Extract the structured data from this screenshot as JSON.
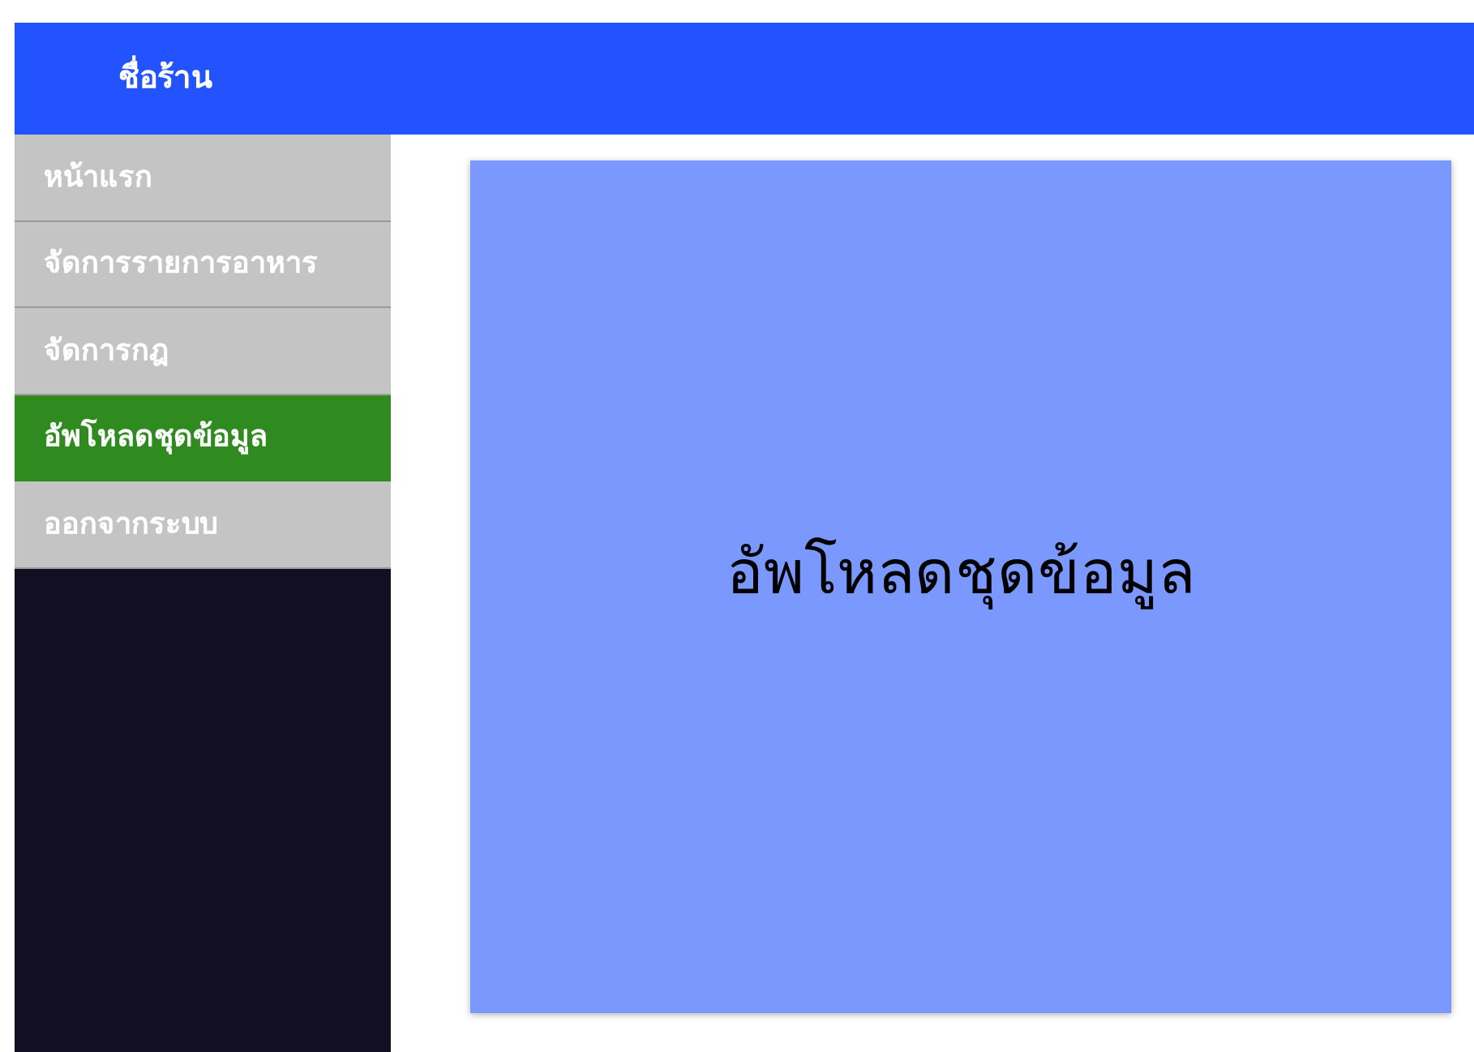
{
  "header": {
    "title": "ชื่อร้าน"
  },
  "sidebar": {
    "items": [
      {
        "label": "หน้าแรก",
        "selected": false
      },
      {
        "label": "จัดการรายการอาหาร",
        "selected": false
      },
      {
        "label": "จัดการกฎ",
        "selected": false
      },
      {
        "label": "อัพโหลดชุดข้อมูล",
        "selected": true
      },
      {
        "label": "ออกจากระบบ",
        "selected": false
      }
    ]
  },
  "main": {
    "heading": "อัพโหลดชุดข้อมูล"
  }
}
